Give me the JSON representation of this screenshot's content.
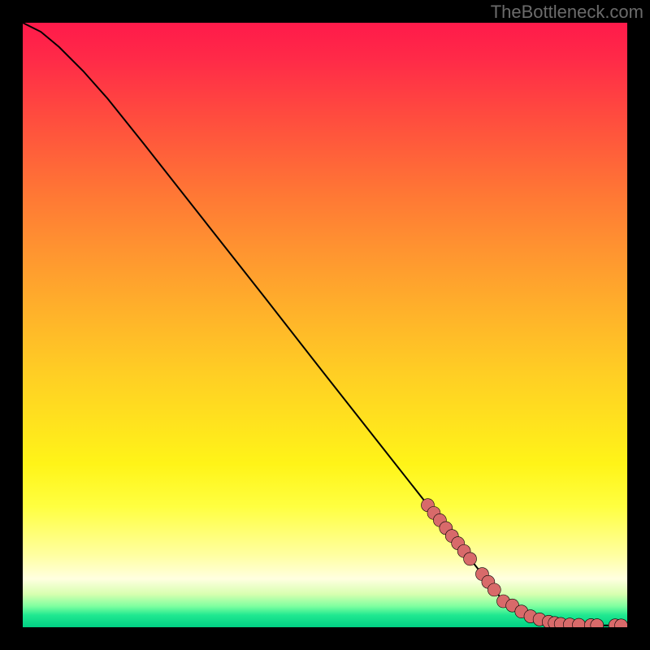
{
  "watermark": "TheBottleneck.com",
  "chart_data": {
    "type": "line",
    "title": "",
    "xlabel": "",
    "ylabel": "",
    "xlim": [
      0,
      100
    ],
    "ylim": [
      0,
      100
    ],
    "curve": {
      "x": [
        0,
        3,
        6,
        10,
        14,
        20,
        30,
        40,
        50,
        60,
        70,
        80,
        85,
        88,
        90,
        92,
        95,
        100
      ],
      "y": [
        100,
        98.5,
        96,
        92,
        87.5,
        80,
        67.3,
        54.6,
        41.8,
        29.1,
        16.4,
        3.7,
        1.2,
        0.6,
        0.4,
        0.35,
        0.3,
        0.3
      ]
    },
    "series": [
      {
        "name": "points",
        "x": [
          67,
          68,
          69,
          70,
          71,
          72,
          73,
          74,
          76,
          77,
          78,
          79.5,
          81,
          82.5,
          84,
          85.5,
          87,
          88,
          89,
          90.5,
          92,
          94,
          95,
          98,
          99
        ],
        "y": [
          20.2,
          18.9,
          17.7,
          16.4,
          15.1,
          13.9,
          12.6,
          11.3,
          8.8,
          7.5,
          6.2,
          4.3,
          3.6,
          2.6,
          1.8,
          1.3,
          0.9,
          0.7,
          0.55,
          0.45,
          0.4,
          0.35,
          0.33,
          0.31,
          0.3
        ]
      }
    ]
  }
}
